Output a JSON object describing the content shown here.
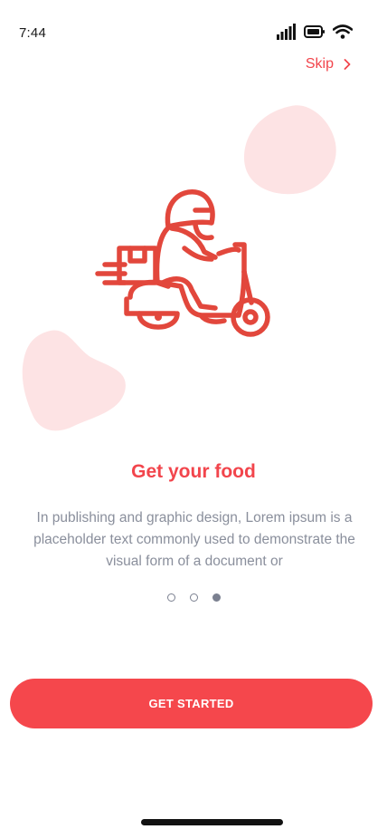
{
  "status_bar": {
    "time": "7:44",
    "icons": [
      "signal-icon",
      "battery-icon",
      "wifi-icon"
    ]
  },
  "header": {
    "skip_label": "Skip",
    "skip_icon": "chevron-right-icon"
  },
  "illustration": {
    "icon": "delivery-scooter-icon",
    "accent_color": "#e2473c",
    "blob_color": "#fde3e4"
  },
  "onboarding": {
    "title": "Get your food",
    "description": "In publishing and graphic design, Lorem ipsum is a placeholder text commonly used to demonstrate the visual form of a document or",
    "pages_total": 3,
    "current_page": 3
  },
  "cta": {
    "label": "GET STARTED",
    "color": "#f5474c"
  }
}
